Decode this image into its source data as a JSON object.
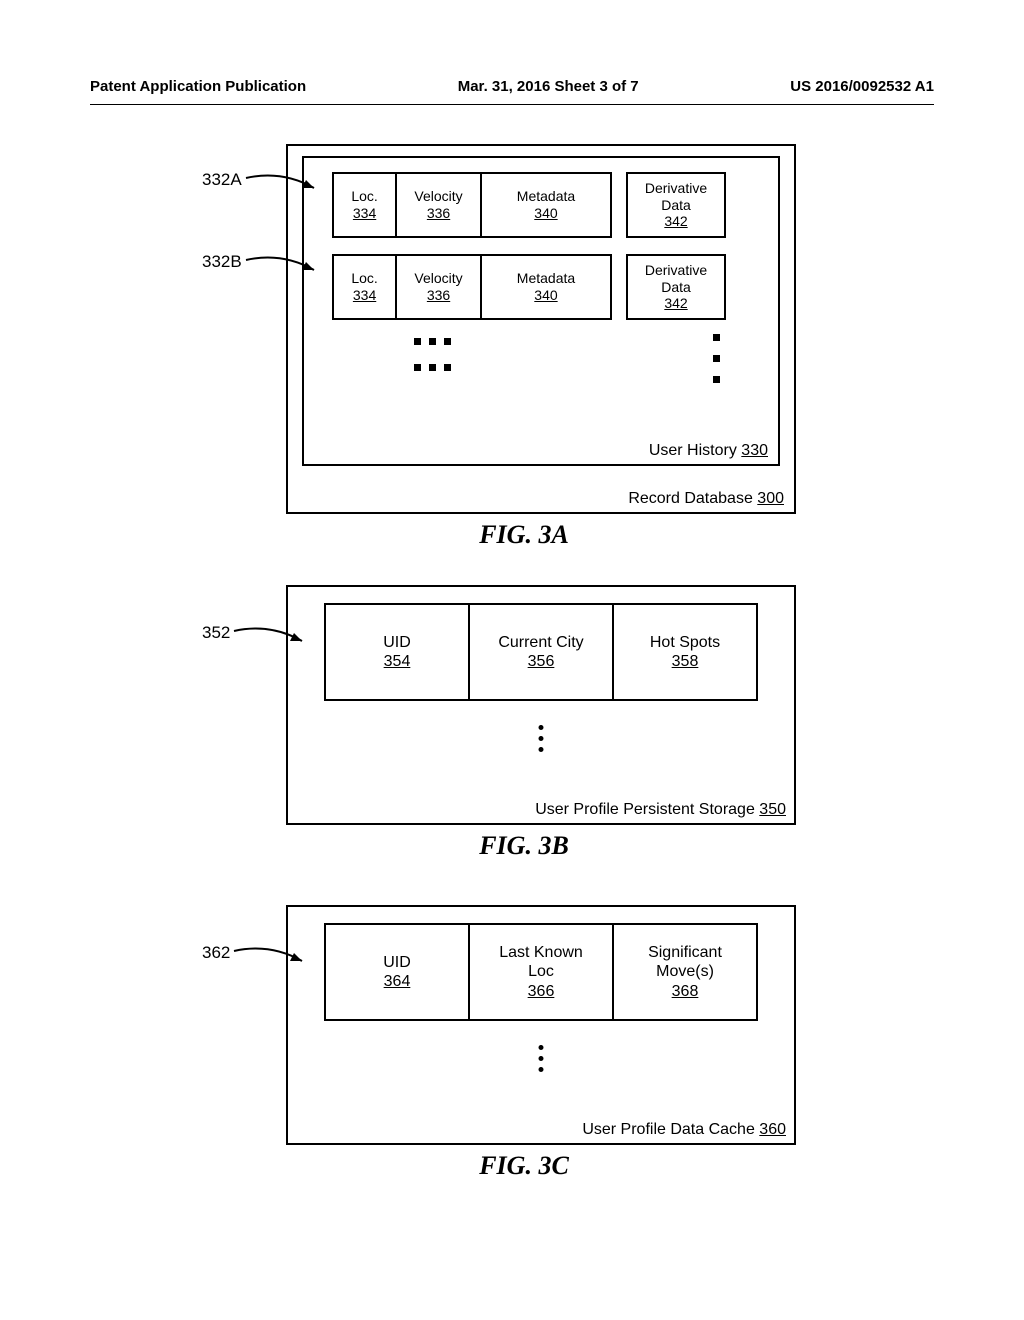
{
  "header": {
    "left": "Patent Application Publication",
    "mid": "Mar. 31, 2016  Sheet 3 of 7",
    "right": "US 2016/0092532 A1"
  },
  "fig3a": {
    "caption": "FIG. 3A",
    "callout1": "332A",
    "callout2": "332B",
    "loc_label": "Loc.",
    "loc_ref": "334",
    "vel_label": "Velocity",
    "vel_ref": "336",
    "meta_label": "Metadata",
    "meta_ref": "340",
    "deriv_label1": "Derivative",
    "deriv_label2": "Data",
    "deriv_ref": "342",
    "inner_label": "User History",
    "inner_ref": "330",
    "outer_label": "Record Database",
    "outer_ref": "300"
  },
  "fig3b": {
    "caption": "FIG. 3B",
    "callout": "352",
    "uid_label": "UID",
    "uid_ref": "354",
    "city_label": "Current City",
    "city_ref": "356",
    "hs_label": "Hot Spots",
    "hs_ref": "358",
    "bottom_label": "User Profile Persistent Storage",
    "bottom_ref": "350"
  },
  "fig3c": {
    "caption": "FIG. 3C",
    "callout": "362",
    "uid_label": "UID",
    "uid_ref": "364",
    "loc_label1": "Last Known",
    "loc_label2": "Loc",
    "loc_ref": "366",
    "mov_label1": "Significant",
    "mov_label2": "Move(s)",
    "mov_ref": "368",
    "bottom_label": "User Profile Data Cache",
    "bottom_ref": "360"
  }
}
